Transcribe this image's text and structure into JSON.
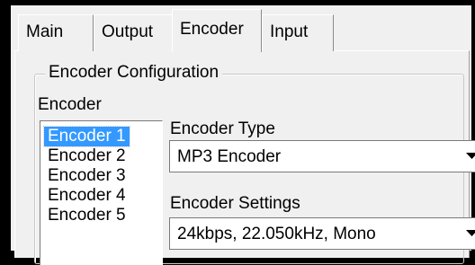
{
  "tabs": [
    {
      "label": "Main",
      "selected": false
    },
    {
      "label": "Output",
      "selected": false
    },
    {
      "label": "Encoder",
      "selected": true
    },
    {
      "label": "Input",
      "selected": false
    }
  ],
  "group": {
    "title": "Encoder Configuration"
  },
  "encoder_list": {
    "label": "Encoder",
    "items": [
      "Encoder 1",
      "Encoder 2",
      "Encoder 3",
      "Encoder 4",
      "Encoder 5"
    ],
    "selected_index": 0
  },
  "encoder_type": {
    "label": "Encoder Type",
    "value": "MP3 Encoder",
    "icon": "chevron-down-icon"
  },
  "encoder_settings": {
    "label": "Encoder Settings",
    "value": "24kbps, 22.050kHz, Mono",
    "icon": "chevron-down-icon"
  },
  "colors": {
    "selection": "#3399ff",
    "background": "#f0f0f0"
  }
}
